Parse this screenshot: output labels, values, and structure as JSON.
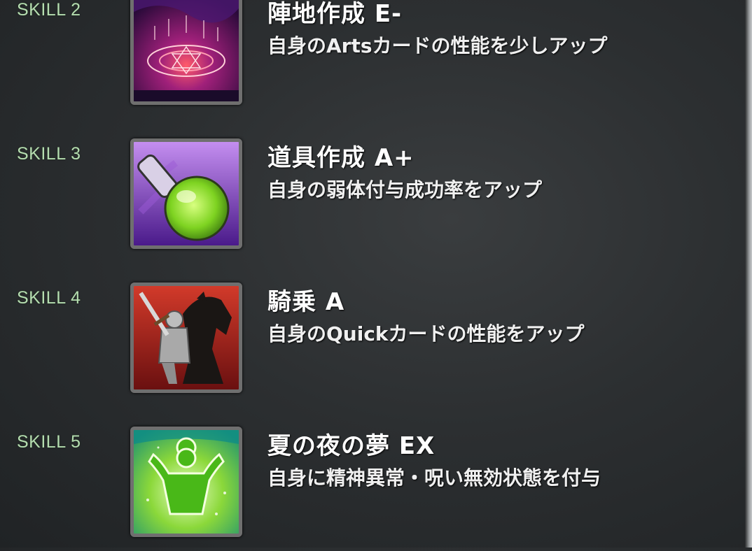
{
  "skills": [
    {
      "label": "SKILL 2",
      "name": "陣地作成 E-",
      "description": "自身のArtsカードの性能を少しアップ",
      "icon": "magic-circle-icon"
    },
    {
      "label": "SKILL 3",
      "name": "道具作成 A+",
      "description": "自身の弱体付与成功率をアップ",
      "icon": "potion-flask-icon"
    },
    {
      "label": "SKILL 4",
      "name": "騎乗 A",
      "description": "自身のQuickカードの性能をアップ",
      "icon": "knight-on-horse-icon"
    },
    {
      "label": "SKILL 5",
      "name": "夏の夜の夢 EX",
      "description": "自身に精神異常・呪い無効状態を付与",
      "icon": "glowing-figure-icon"
    }
  ],
  "colors": {
    "label": "#b5ddb0",
    "background": "#2c2f31",
    "text": "#ffffff"
  }
}
